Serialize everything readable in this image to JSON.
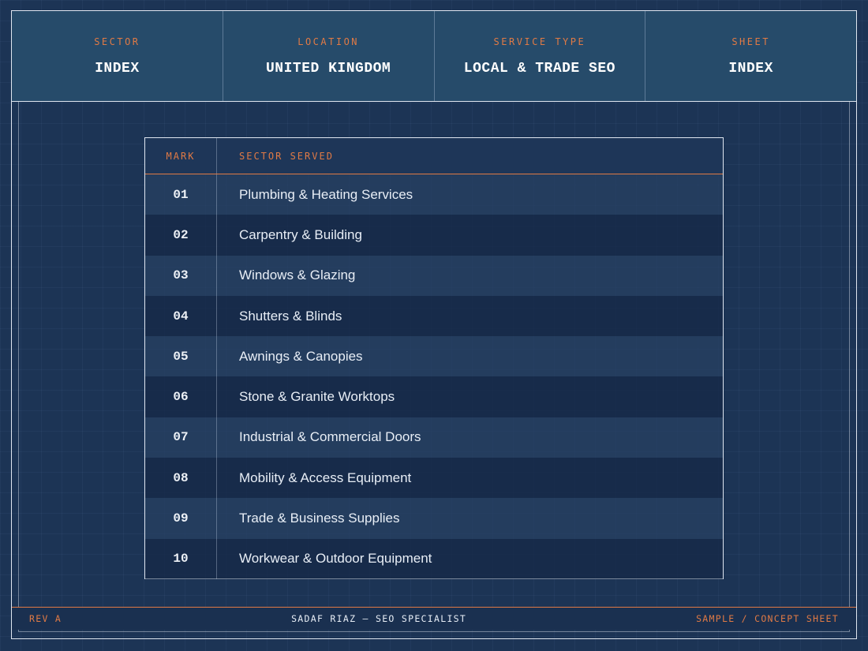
{
  "title_block": [
    {
      "label": "SECTOR",
      "value": "INDEX"
    },
    {
      "label": "LOCATION",
      "value": "UNITED KINGDOM"
    },
    {
      "label": "SERVICE TYPE",
      "value": "LOCAL & TRADE SEO"
    },
    {
      "label": "SHEET",
      "value": "INDEX"
    }
  ],
  "table": {
    "headers": {
      "mark": "MARK",
      "sector": "SECTOR SERVED"
    },
    "rows": [
      {
        "mark": "01",
        "sector": "Plumbing & Heating Services"
      },
      {
        "mark": "02",
        "sector": "Carpentry & Building"
      },
      {
        "mark": "03",
        "sector": "Windows & Glazing"
      },
      {
        "mark": "04",
        "sector": "Shutters & Blinds"
      },
      {
        "mark": "05",
        "sector": "Awnings & Canopies"
      },
      {
        "mark": "06",
        "sector": "Stone & Granite Worktops"
      },
      {
        "mark": "07",
        "sector": "Industrial & Commercial Doors"
      },
      {
        "mark": "08",
        "sector": "Mobility & Access Equipment"
      },
      {
        "mark": "09",
        "sector": "Trade & Business Supplies"
      },
      {
        "mark": "10",
        "sector": "Workwear & Outdoor Equipment"
      }
    ]
  },
  "footer": {
    "left": "REV A",
    "center": "SADAF RIAZ — SEO SPECIALIST",
    "right": "SAMPLE / CONCEPT SHEET"
  },
  "colors": {
    "background": "#1c3455",
    "accent": "#e07a45",
    "line": "#dfe6f0"
  }
}
